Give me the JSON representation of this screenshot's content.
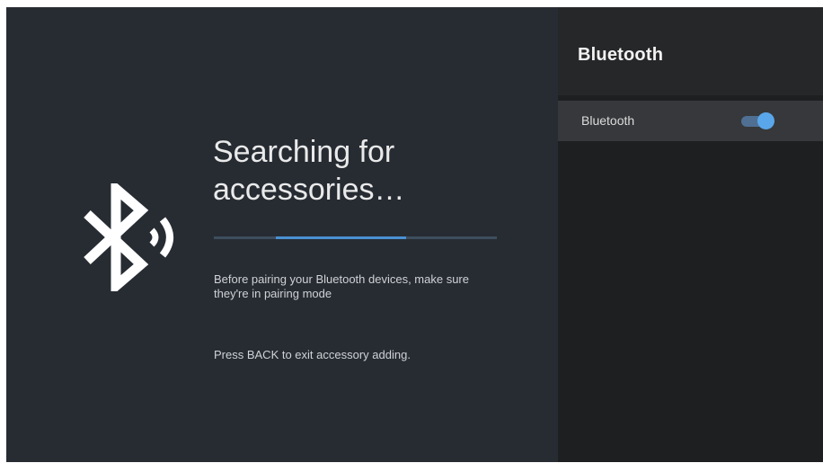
{
  "main": {
    "heading_line1": "Searching for",
    "heading_line2": "accessories…",
    "progress_fraction": 0.46,
    "description": "Before pairing your Bluetooth devices, make sure they're in pairing mode",
    "back_hint": "Press BACK to exit accessory adding.",
    "icon": "bluetooth-searching-icon"
  },
  "side_panel": {
    "title": "Bluetooth",
    "items": [
      {
        "label": "Bluetooth",
        "toggle_on": true
      }
    ]
  },
  "colors": {
    "main_bg": "#272c33",
    "side_bg": "#1e1f21",
    "accent": "#5aa6ea",
    "progress_track": "#3d4d5e"
  }
}
